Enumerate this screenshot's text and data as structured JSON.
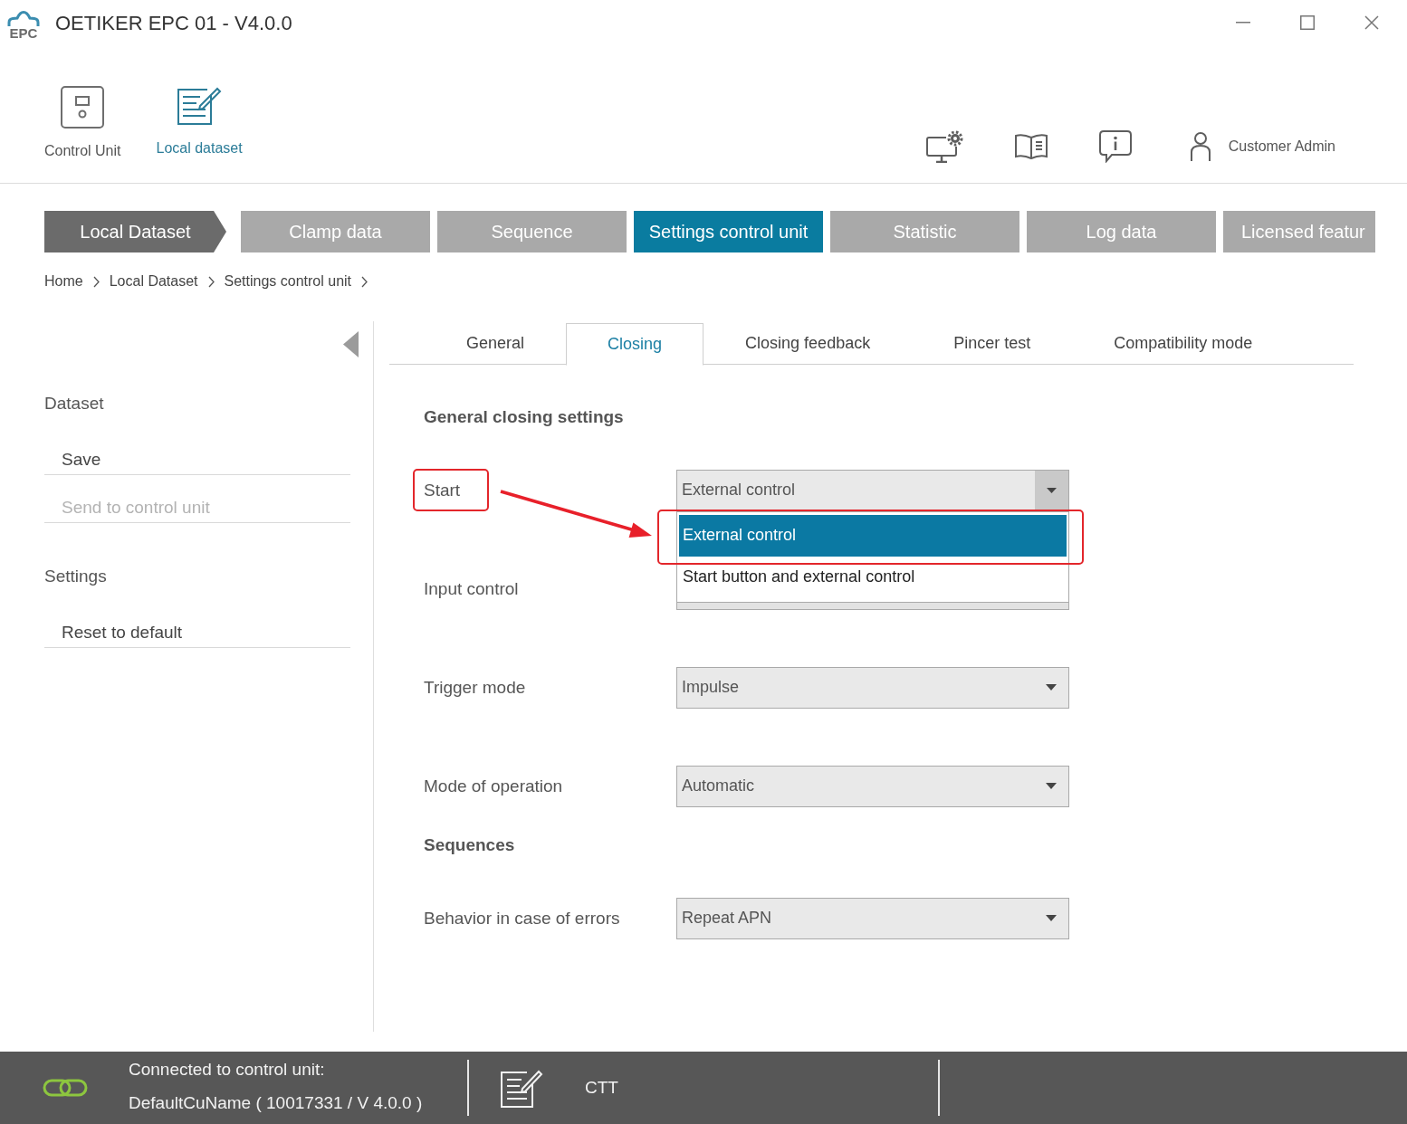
{
  "window": {
    "logo_text": "EPC",
    "title": "OETIKER EPC 01 - V4.0.0"
  },
  "toolbar": {
    "items": [
      {
        "kind": "control-unit",
        "label": "Control Unit",
        "selected": false
      },
      {
        "kind": "dataset",
        "label": "Local dataset",
        "selected": true
      }
    ],
    "user": "Customer Admin"
  },
  "nav_tabs": [
    {
      "kind": "root",
      "label": "Local Dataset",
      "selected": false
    },
    {
      "kind": "step",
      "label": "Clamp data",
      "selected": false
    },
    {
      "kind": "step",
      "label": "Sequence",
      "selected": false
    },
    {
      "kind": "step",
      "label": "Settings control unit",
      "selected": true
    },
    {
      "kind": "step",
      "label": "Statistic",
      "selected": false
    },
    {
      "kind": "step",
      "label": "Log data",
      "selected": false
    },
    {
      "kind": "step",
      "label": "Licensed featur",
      "selected": false
    }
  ],
  "breadcrumb": [
    "Home",
    "Local Dataset",
    "Settings control unit"
  ],
  "sidebar": {
    "groups": [
      {
        "heading": "Dataset",
        "items": [
          {
            "label": "Save",
            "disabled": false
          },
          {
            "label": "Send to control unit",
            "disabled": true
          }
        ]
      },
      {
        "heading": "Settings",
        "items": [
          {
            "label": "Reset to default",
            "disabled": false
          }
        ]
      }
    ]
  },
  "subtabs": [
    {
      "label": "General",
      "selected": false
    },
    {
      "label": "Closing",
      "selected": true
    },
    {
      "label": "Closing feedback",
      "selected": false
    },
    {
      "label": "Pincer test",
      "selected": false
    },
    {
      "label": "Compatibility mode",
      "selected": false
    }
  ],
  "form": {
    "rows": [
      {
        "kind": "heading",
        "text": "General closing settings"
      },
      {
        "kind": "select",
        "label": "Start",
        "value": "External control",
        "highlighted": true,
        "open": true,
        "options": [
          {
            "label": "External control",
            "selected": true,
            "highlighted": true
          },
          {
            "label": "Start button and external control",
            "selected": false,
            "highlighted": false
          }
        ]
      },
      {
        "kind": "label",
        "label": "Input control",
        "highlighted": false
      },
      {
        "kind": "select",
        "label": "Trigger mode",
        "value": "Impulse",
        "highlighted": false,
        "open": false
      },
      {
        "kind": "select",
        "label": "Mode of operation",
        "value": "Automatic",
        "highlighted": false,
        "open": false
      },
      {
        "kind": "heading",
        "text": "Sequences"
      },
      {
        "kind": "select",
        "label": "Behavior in case of errors",
        "value": "Repeat APN",
        "highlighted": false,
        "open": false
      }
    ]
  },
  "annotation_arrow": true,
  "status_bar": {
    "connected": true,
    "connection_label": "Connected to control unit:",
    "device": "DefaultCuName ( 10017331 / V 4.0.0 )",
    "mode": "CTT"
  }
}
